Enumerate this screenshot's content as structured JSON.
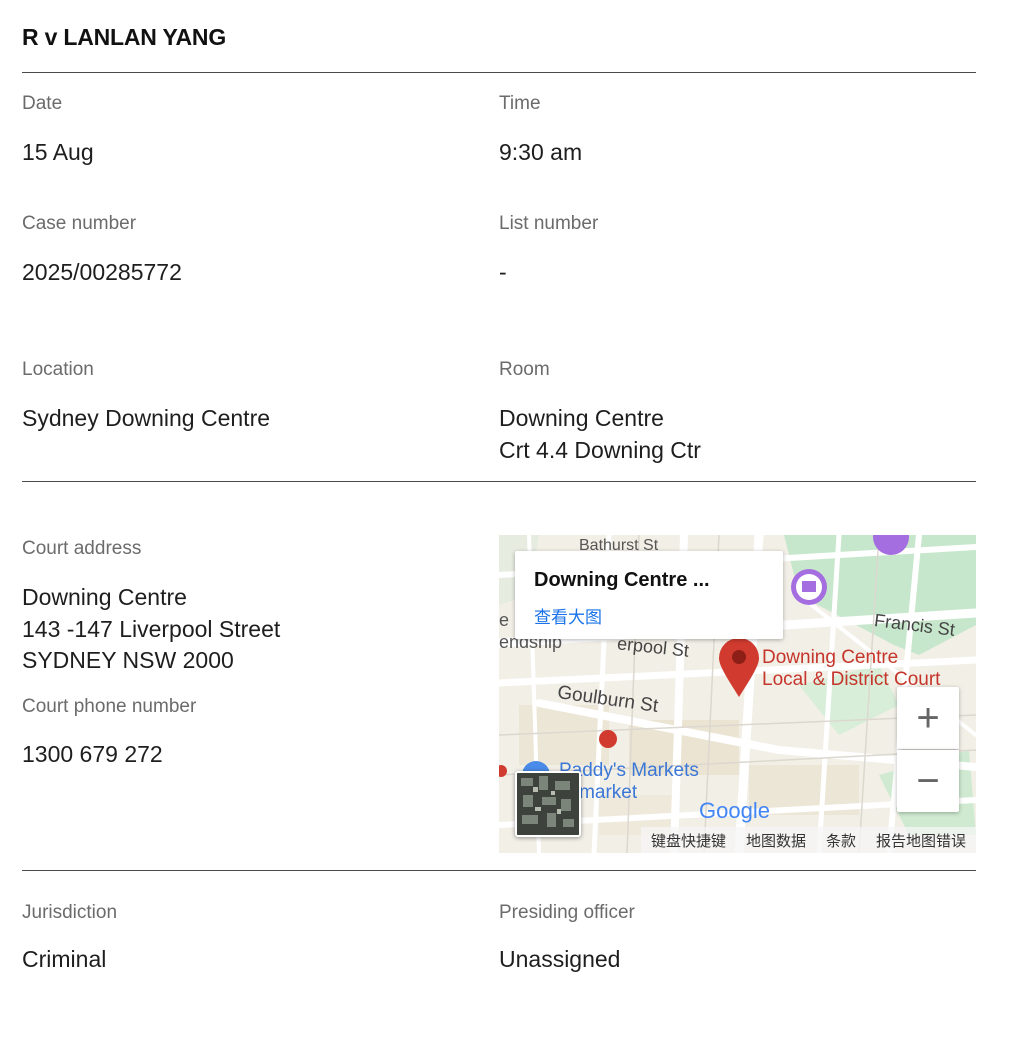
{
  "case": {
    "title": "R v LANLAN YANG"
  },
  "details": {
    "date": {
      "label": "Date",
      "value": "15 Aug"
    },
    "time": {
      "label": "Time",
      "value": "9:30 am"
    },
    "case_number": {
      "label": "Case number",
      "value": "2025/00285772"
    },
    "list_number": {
      "label": "List number",
      "value": "-"
    },
    "location": {
      "label": "Location",
      "value": "Sydney Downing Centre"
    },
    "room": {
      "label": "Room",
      "lines": [
        "Downing Centre",
        "Crt 4.4 Downing Ctr"
      ]
    },
    "court_address": {
      "label": "Court address",
      "lines": [
        "Downing Centre",
        "143 -147 Liverpool Street",
        "SYDNEY NSW 2000"
      ]
    },
    "court_phone": {
      "label": "Court phone number",
      "value": "1300 679 272"
    },
    "jurisdiction": {
      "label": "Jurisdiction",
      "value": "Criminal"
    },
    "presiding_officer": {
      "label": "Presiding officer",
      "value": "Unassigned"
    }
  },
  "map": {
    "info_card": {
      "place": "Downing Centre ...",
      "link": "查看大图"
    },
    "marker_label_line1": "Downing Centre",
    "marker_label_line2": "Local & District Court",
    "streets": {
      "bathurst": "Bathurst St",
      "liverpool": "erpool St",
      "goulburn": "Goulburn St",
      "francis": "Francis St",
      "friendship": "endship",
      "left_e": "e"
    },
    "poi": {
      "paddys_line1": "Paddy's Markets",
      "paddys_line2": "aymarket"
    },
    "google_logo": "Google",
    "footer": {
      "shortcuts": "键盘快捷键",
      "map_data": "地图数据",
      "terms": "条款",
      "report": "报告地图错误"
    },
    "zoom_in": "+",
    "zoom_out": "−",
    "colors": {
      "park": "#c7e7cc",
      "water": "#aadaff",
      "marker": "#d13b2f",
      "label": "#c5352b",
      "link": "#1a73e8"
    }
  }
}
